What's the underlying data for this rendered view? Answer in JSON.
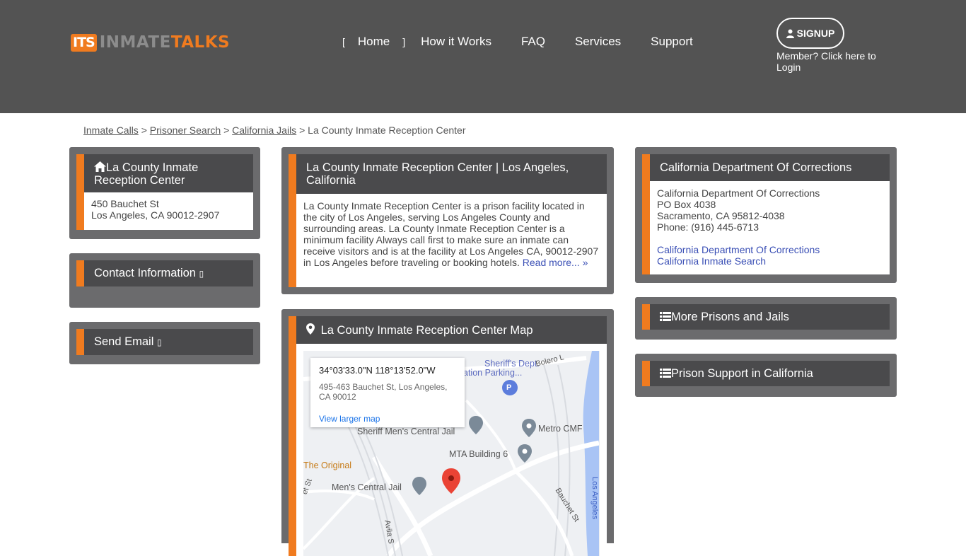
{
  "header": {
    "logo_badge": "ITS",
    "logo_text_a": "INMATE",
    "logo_text_b": "TALKS",
    "nav": {
      "open_bracket": "[",
      "home": "Home",
      "close_bracket": "]",
      "items": [
        "How it Works",
        "FAQ",
        "Services",
        "Support"
      ]
    },
    "signup_label": "SIGNUP",
    "member_text": "Member? Click here to Login"
  },
  "breadcrumb": {
    "items": [
      "Inmate Calls",
      "Prisoner Search",
      "California Jails"
    ],
    "separator": ">",
    "current": "La County Inmate Reception Center"
  },
  "left": {
    "facility_title": "La County Inmate Reception Center",
    "address_line1": "450 Bauchet St",
    "address_line2": "Los Angeles, CA 90012-2907",
    "contact_title": "Contact Information",
    "send_email_title": "Send Email",
    "placeholder_glyph": "▯"
  },
  "center": {
    "title": "La County Inmate Reception Center | Los Angeles, California",
    "description": "La County Inmate Reception Center is a prison facility located in the city of Los Angeles, serving Los Angeles County and surrounding areas. La County Inmate Reception Center is a minimum facility Always call first to make sure an inmate can receive visitors and is at the facility at Los Angeles CA, 90012-2907 in Los Angeles before traveling or booking hotels.",
    "read_more": "Read more... »",
    "map_title": "La County Inmate Reception Center Map",
    "map": {
      "coord": "34°03'33.0\"N 118°13'52.0\"W",
      "addr": "495-463 Bauchet St, Los Angeles, CA 90012",
      "larger": "View larger map",
      "labels": {
        "sheriff_dept": "Sheriff's Dept.",
        "parking": "ation Parking...",
        "bolero": "Bolero L",
        "mens_central_top": "Sheriff Men's Central Jail",
        "metro_cmf": "Metro CMF",
        "mta": "MTA Building 6",
        "original": "The Original",
        "mens_central": "Men's Central Jail",
        "bauchet": "Bauchet St",
        "avila": "Avila S",
        "los_angeles": "Los Angeles",
        "et_st": "et St",
        "parking_letter": "P"
      }
    }
  },
  "right": {
    "doc_title": "California Department Of Corrections",
    "doc_lines": [
      "California Department Of Corrections",
      "PO Box 4038",
      "Sacramento, CA 95812-4038",
      "Phone: (916) 445-6713"
    ],
    "doc_links": [
      "California Department Of Corrections",
      "California Inmate Search"
    ],
    "more_prisons": "More Prisons and Jails",
    "prison_support": "Prison Support in California"
  },
  "colors": {
    "header_bg": "#535353",
    "accent": "#f07b1f",
    "panel_bg": "#6b6b6d",
    "panel_head": "#4a4a4c",
    "link": "#3a4fb5"
  }
}
